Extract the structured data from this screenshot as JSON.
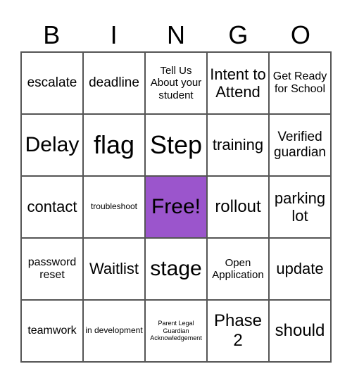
{
  "header": [
    "B",
    "I",
    "N",
    "G",
    "O"
  ],
  "cells": [
    [
      "escalate",
      "deadline",
      "Tell Us About your student",
      "Intent to Attend",
      "Get Ready for School"
    ],
    [
      "Delay",
      "flag",
      "Step",
      "training",
      "Verified guardian"
    ],
    [
      "contact",
      "troubleshoot",
      "Free!",
      "rollout",
      "parking lot"
    ],
    [
      "password reset",
      "Waitlist",
      "stage",
      "Open Application",
      "update"
    ],
    [
      "teamwork",
      "in development",
      "Parent Legal Guardian Acknowledgement",
      "Phase 2",
      "should"
    ]
  ],
  "free_cell_color": "#9b55cc"
}
